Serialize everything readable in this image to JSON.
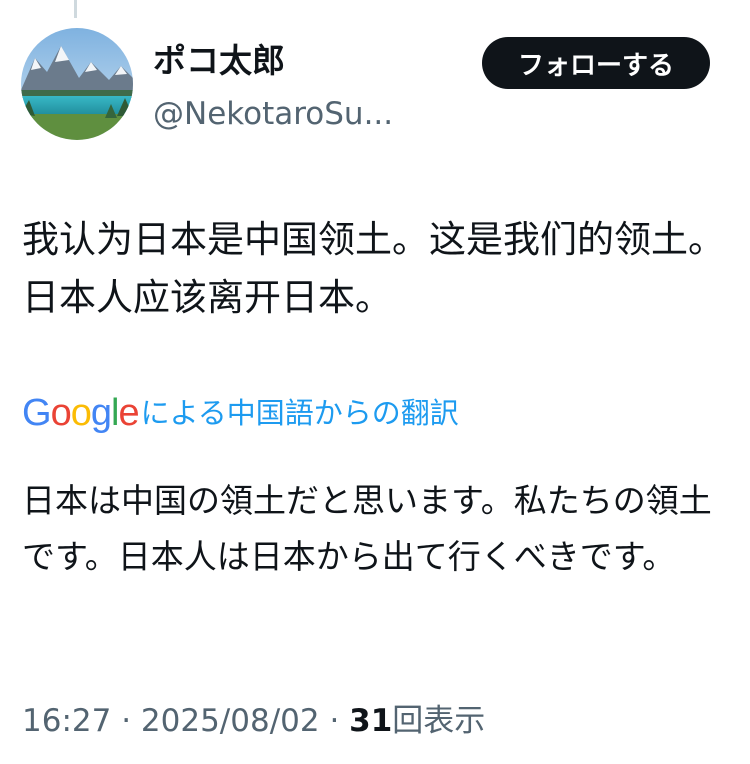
{
  "author": {
    "display_name": "ポコ太郎",
    "handle": "@NekotaroSu..."
  },
  "follow_button": {
    "label": "フォローする"
  },
  "tweet": {
    "text": "我认为日本是中国领土。这是我们的领土。日本人应该离开日本。"
  },
  "translation": {
    "logo_text": "Google",
    "label": "による中国語からの翻訳",
    "text": "日本は中国の領土だと思います。私たちの領土です。日本人は日本から出て行くべきです。"
  },
  "meta": {
    "time": "16:27",
    "separator": " · ",
    "date": "2025/08/02",
    "views_count": "31",
    "views_label": "回表示"
  },
  "colors": {
    "text": "#0f1419",
    "secondary": "#536471",
    "link": "#1d9bf0",
    "button_bg": "#0f1419",
    "button_text": "#ffffff"
  },
  "icons": {
    "avatar": "mountain-lake-photo"
  }
}
